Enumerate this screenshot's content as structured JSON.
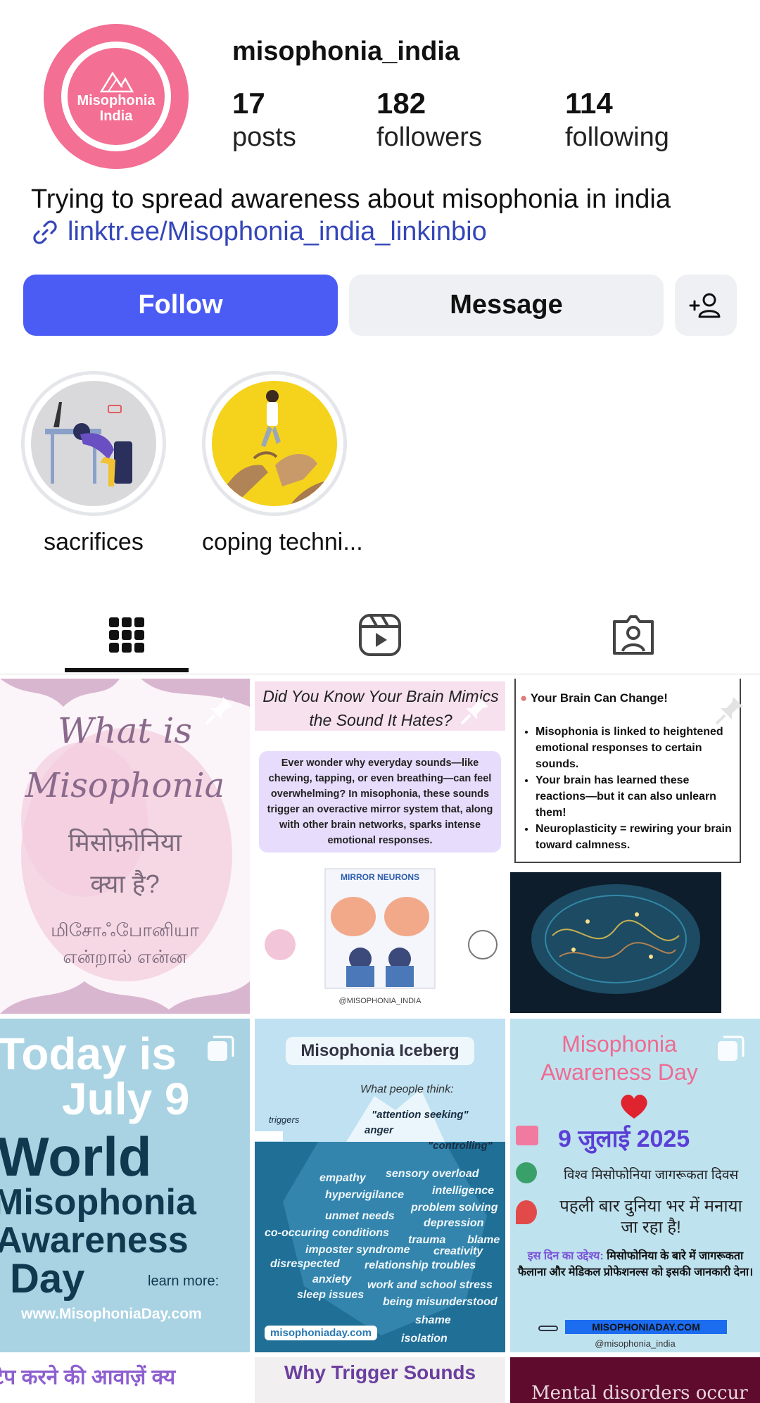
{
  "profile": {
    "username": "misophonia_india",
    "avatar_text": "Misophonia India",
    "stats": [
      {
        "value": "17",
        "label": "posts"
      },
      {
        "value": "182",
        "label": "followers"
      },
      {
        "value": "114",
        "label": "following"
      }
    ],
    "bio": "Trying to spread awareness about misophonia in india",
    "link": "linktr.ee/Misophonia_india_linkinbio"
  },
  "actions": {
    "follow_label": "Follow",
    "message_label": "Message",
    "add_person_icon": "add-person-icon"
  },
  "highlights": [
    {
      "label": "sacrifices"
    },
    {
      "label": "coping techni..."
    }
  ],
  "tabs": [
    "grid-icon",
    "reels-icon",
    "tagged-icon"
  ],
  "posts": [
    {
      "lines": [
        "What is",
        "Misophonia",
        "मिसोफ़ोनिया",
        "क्या है?",
        "மிசோஃபோனியா",
        "என்றால் என்ன"
      ]
    },
    {
      "title": "Did You Know Your Brain Mimics the Sound It Hates?",
      "body": "Ever wonder why everyday sounds—like chewing, tapping, or even breathing—can feel overwhelming? In misophonia, these sounds trigger an overactive mirror system that, along with other brain networks, sparks intense emotional responses.",
      "diagram_label": "MIRROR NEURONS",
      "handle": "@MISOPHONIA_INDIA"
    },
    {
      "title": "Your Brain Can Change!",
      "bullets": [
        "Misophonia is linked to heightened emotional responses to certain sounds.",
        "Your brain has learned these reactions—but it can also unlearn them!",
        "Neuroplasticity = rewiring your brain toward calmness."
      ]
    },
    {
      "lines": [
        "Today is",
        "July 9",
        "World",
        "Misophonia",
        "Awareness",
        "Day"
      ],
      "learn_more": "learn more:",
      "site": "www.MisophoniaDay.com"
    },
    {
      "title": "Misophonia Iceberg",
      "subtitle": "What people think:",
      "above": [
        "\"attention seeking\"",
        "anger",
        "\"controlling\"",
        "triggers"
      ],
      "below": [
        "empathy",
        "sensory overload",
        "hypervigilance",
        "intelligence",
        "problem solving",
        "unmet needs",
        "depression",
        "co-occuring conditions",
        "trauma",
        "blame",
        "imposter syndrome",
        "creativity",
        "disrespected",
        "relationship troubles",
        "anxiety",
        "work and school stress",
        "sleep issues",
        "being misunderstood",
        "shame",
        "isolation"
      ],
      "site": "misophoniaday.com"
    },
    {
      "title": "Misophonia Awareness Day",
      "date": "9 जुलाई 2025",
      "line1": "विश्व मिसोफोनिया जागरूकता दिवस",
      "line2": "पहली बार दुनिया भर में मनाया जा रहा है!",
      "purpose_label": "इस दिन का उद्देश्य:",
      "purpose": "मिसोफोनिया के बारे में जागरूकता फैलाना और मेडिकल प्रोफेशनल्स को इसकी जानकारी देना।",
      "site": "MISOPHONIADAY.COM",
      "handle": "@misophonia_india"
    },
    {
      "text": "टैप करने की आवाज़ें क्य"
    },
    {
      "text": "Why Trigger Sounds"
    },
    {
      "text": "Mental disorders occur"
    }
  ],
  "colors": {
    "accent": "#4a5cf4",
    "avatar": "#f36f93",
    "link": "#3446b8"
  }
}
